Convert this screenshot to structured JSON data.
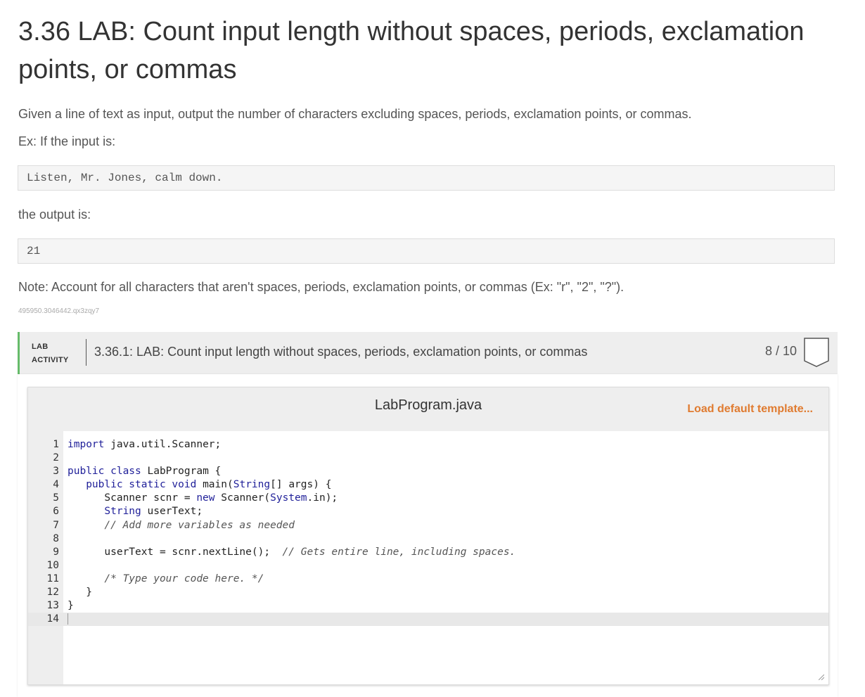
{
  "page": {
    "title": "3.36 LAB: Count input length without spaces, periods, exclamation points, or commas",
    "description": "Given a line of text as input, output the number of characters excluding spaces, periods, exclamation points, or commas.",
    "example_intro": "Ex: If the input is:",
    "example_input": "Listen, Mr. Jones, calm down.",
    "output_intro": "the output is:",
    "example_output": "21",
    "note": "Note: Account for all characters that aren't spaces, periods, exclamation points, or commas (Ex: \"r\", \"2\", \"?\").",
    "identifier": "495950.3046442.qx3zqy7"
  },
  "lab_activity": {
    "tag_line1": "LAB",
    "tag_line2": "ACTIVITY",
    "title": "3.36.1: LAB: Count input length without spaces, periods, exclamation points, or commas",
    "score": "8 / 10",
    "accent_color": "#66bb6a"
  },
  "editor": {
    "filename": "LabProgram.java",
    "load_template_label": "Load default template...",
    "load_template_color": "#e07b30",
    "line_numbers": [
      "1",
      "2",
      "3",
      "4",
      "5",
      "6",
      "7",
      "8",
      "9",
      "10",
      "11",
      "12",
      "13",
      "14"
    ],
    "lines": [
      "import java.util.Scanner;",
      "",
      "public class LabProgram {",
      "   public static void main(String[] args) {",
      "      Scanner scnr = new Scanner(System.in);",
      "      String userText;",
      "      // Add more variables as needed",
      "",
      "      userText = scnr.nextLine();  // Gets entire line, including spaces.",
      "",
      "      /* Type your code here. */",
      "   }",
      "}",
      ""
    ],
    "active_line": 14
  }
}
